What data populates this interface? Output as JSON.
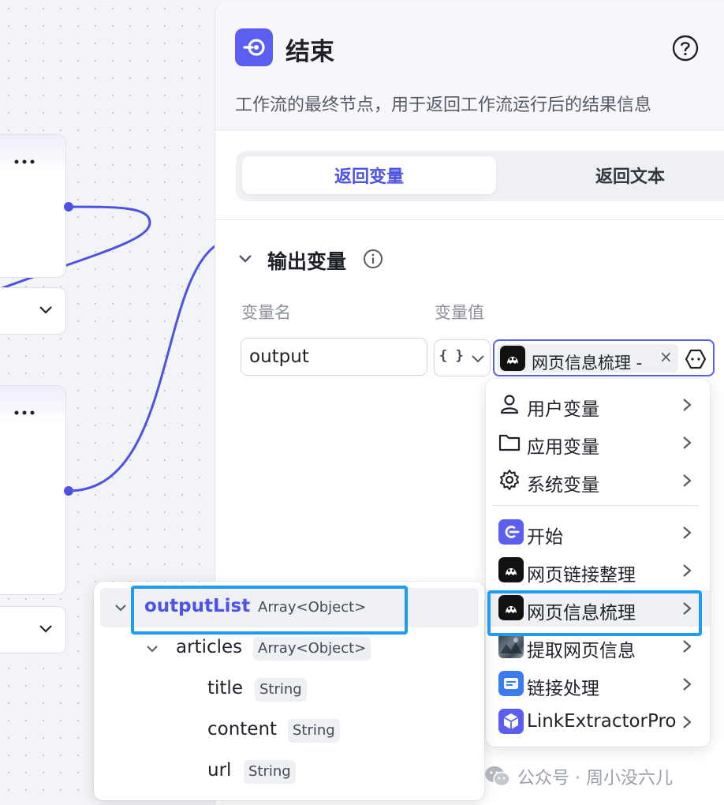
{
  "panel": {
    "title": "结束",
    "description": "工作流的最终节点，用于返回工作流运行后的结果信息",
    "tabs": [
      "返回变量",
      "返回文本"
    ],
    "section_title": "输出变量",
    "columns": {
      "name": "变量名",
      "value": "变量值"
    },
    "row": {
      "name_value": "output",
      "type_icon": "{ }",
      "value_chip": "网页信息梳理 -",
      "close": "×"
    }
  },
  "menu": {
    "items": [
      {
        "label": "用户变量",
        "icon": "user-icon"
      },
      {
        "label": "应用变量",
        "icon": "folder-icon"
      },
      {
        "label": "系统变量",
        "icon": "gear-icon"
      },
      {
        "label": "开始",
        "icon": "start-node-icon"
      },
      {
        "label": "网页链接整理",
        "icon": "ghost-icon"
      },
      {
        "label": "网页信息梳理",
        "icon": "ghost-icon"
      },
      {
        "label": "提取网页信息",
        "icon": "image-thumbnail-icon"
      },
      {
        "label": "链接处理",
        "icon": "str-icon"
      },
      {
        "label": "LinkExtractorPro",
        "icon": "cube-icon"
      }
    ]
  },
  "tree": {
    "rows": [
      {
        "name": "outputList",
        "type": "Array<Object>"
      },
      {
        "name": "articles",
        "type": "Array<Object>"
      },
      {
        "name": "title",
        "type": "String"
      },
      {
        "name": "content",
        "type": "String"
      },
      {
        "name": "url",
        "type": "String"
      }
    ]
  },
  "watermark": "公众号 · 周小没六儿",
  "colors": {
    "accent": "#4d53e8",
    "highlight_box": "#1f9bf0",
    "edge": "#4e52e3"
  }
}
